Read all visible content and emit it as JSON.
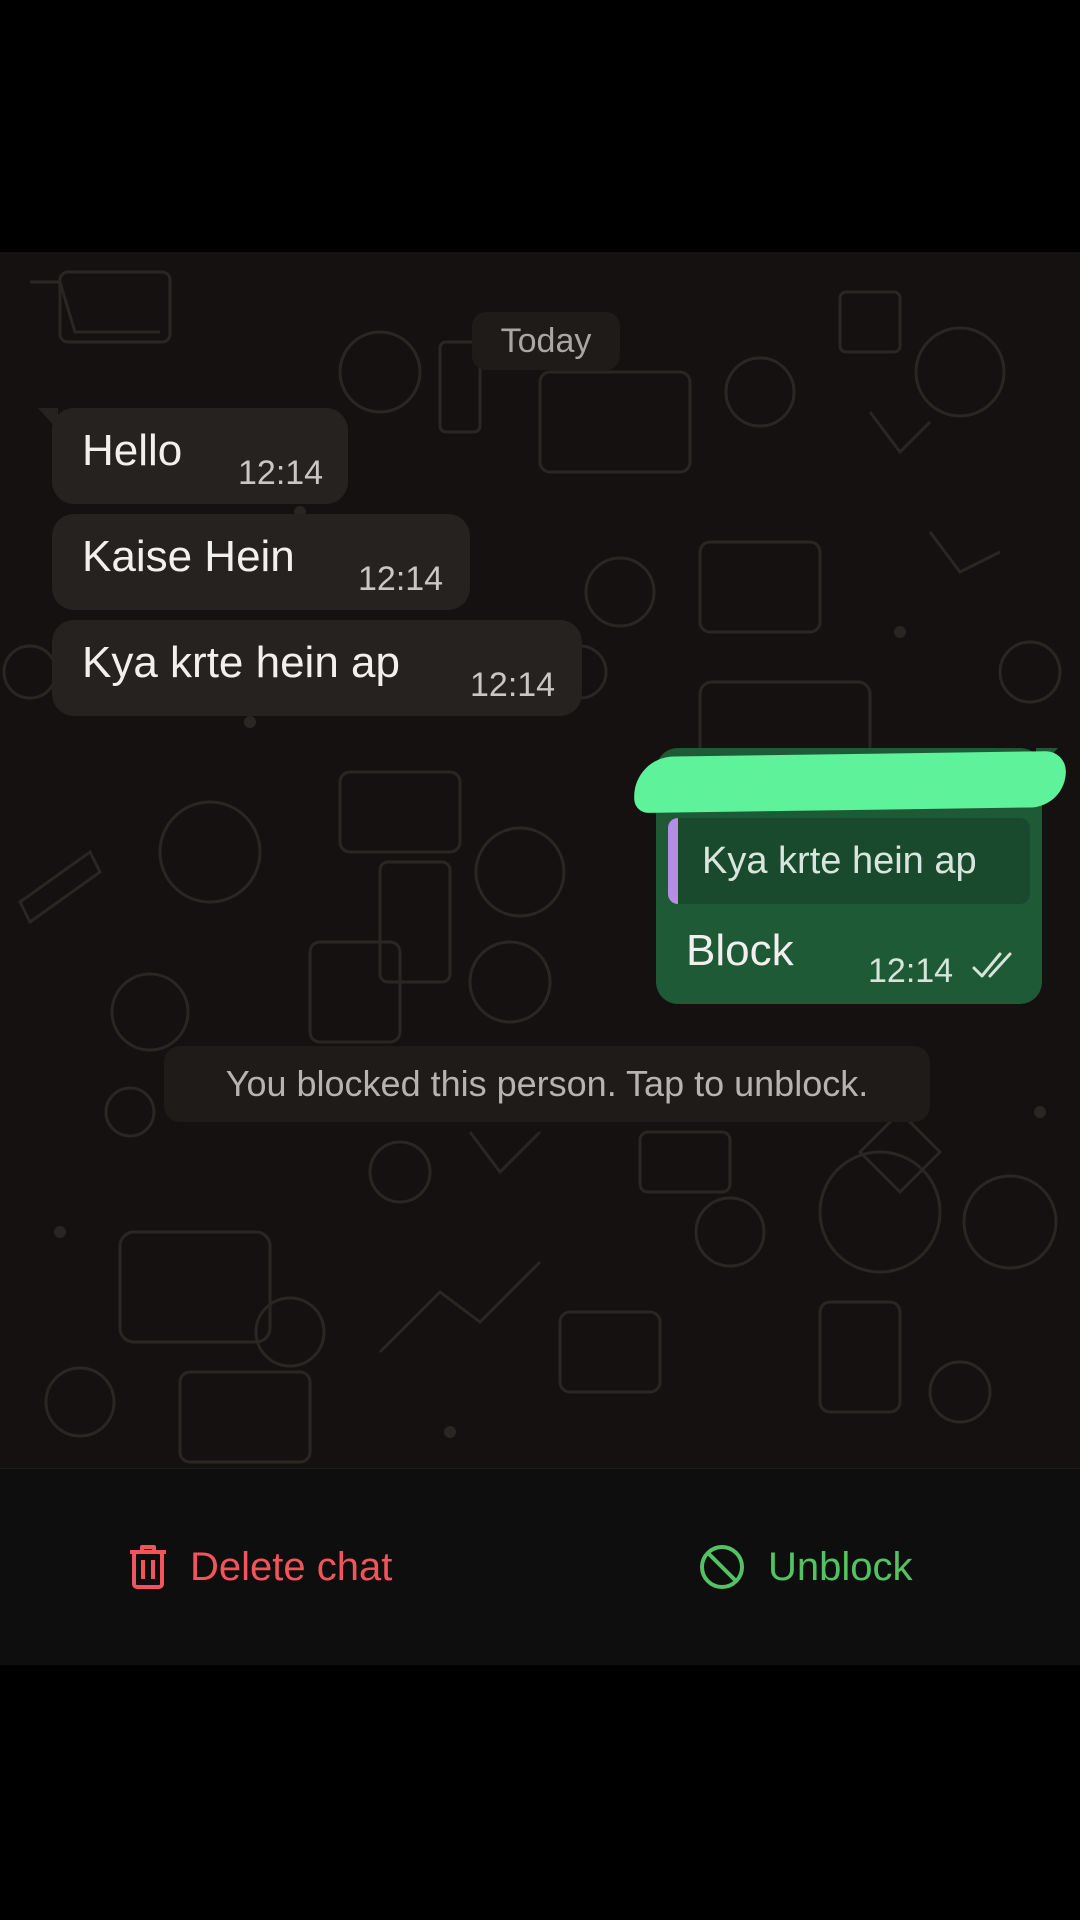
{
  "colors": {
    "chat_background": "#141110",
    "incoming_bubble": "#252220",
    "outgoing_bubble": "#1f5a37",
    "redaction_highlight": "#5ef29a",
    "quote_accent": "#b48ee6",
    "delete_red": "#f2545b",
    "unblock_green": "#53c262"
  },
  "conversation": {
    "date_separator": "Today",
    "incoming_messages": [
      {
        "text": "Hello",
        "time": "12:14"
      },
      {
        "text": "Kaise Hein",
        "time": "12:14"
      },
      {
        "text": "Kya krte hein ap",
        "time": "12:14"
      }
    ],
    "outgoing_message": {
      "quoted_text": "Kya krte hein ap",
      "text": "Block",
      "time": "12:14",
      "status_icon": "double-check-icon"
    },
    "system_notice": "You blocked this person. Tap to unblock."
  },
  "actions": {
    "delete": {
      "label": "Delete chat",
      "icon": "trash-icon"
    },
    "unblock": {
      "label": "Unblock",
      "icon": "block-circle-icon"
    }
  }
}
